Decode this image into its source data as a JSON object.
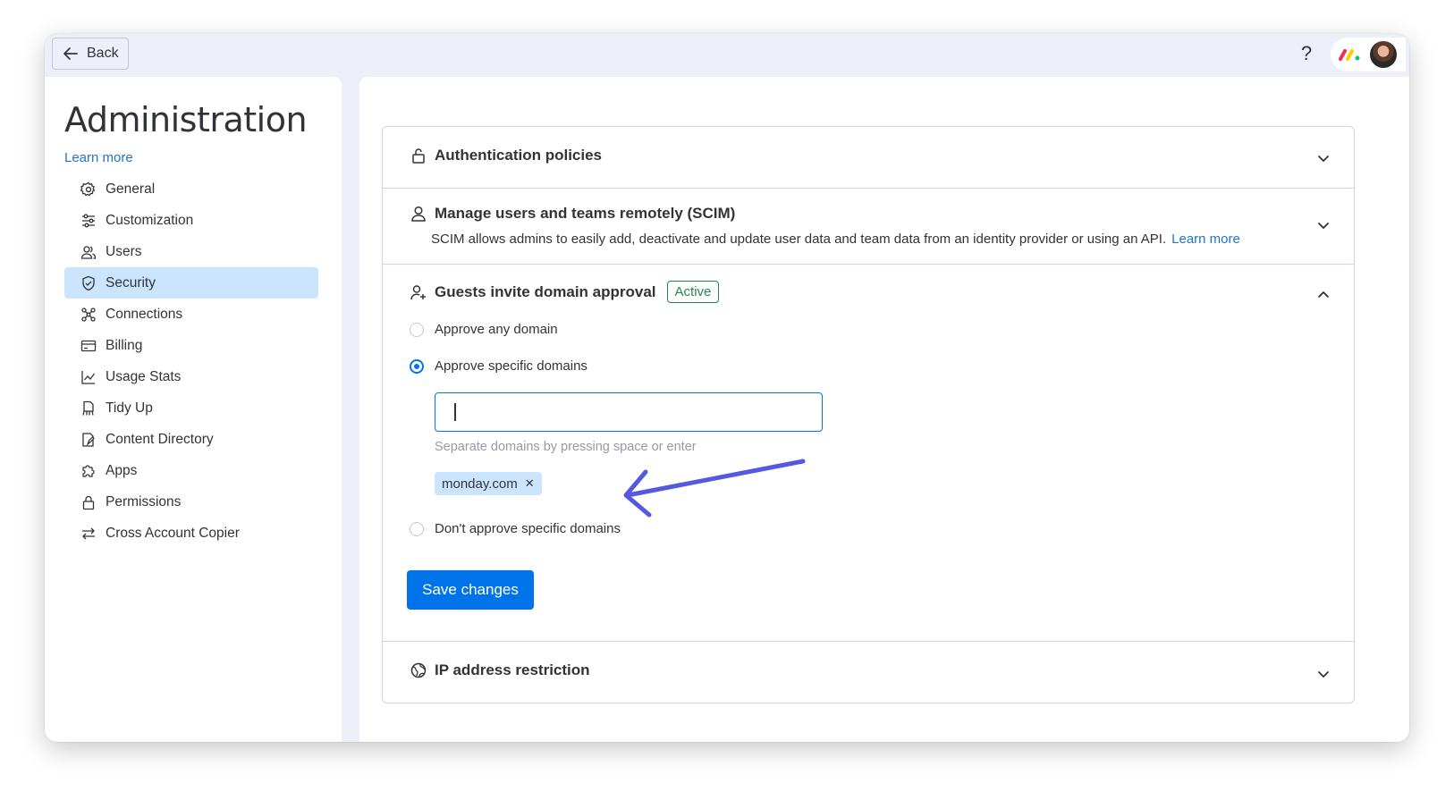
{
  "topbar": {
    "back_label": "Back",
    "help_glyph": "?"
  },
  "sidebar": {
    "title": "Administration",
    "learn_more": "Learn more",
    "items": [
      {
        "label": "General",
        "icon": "gear-icon"
      },
      {
        "label": "Customization",
        "icon": "sliders-icon"
      },
      {
        "label": "Users",
        "icon": "users-icon"
      },
      {
        "label": "Security",
        "icon": "shield-icon",
        "active": true
      },
      {
        "label": "Connections",
        "icon": "connections-icon"
      },
      {
        "label": "Billing",
        "icon": "credit-card-icon"
      },
      {
        "label": "Usage Stats",
        "icon": "chart-icon"
      },
      {
        "label": "Tidy Up",
        "icon": "broom-icon"
      },
      {
        "label": "Content Directory",
        "icon": "document-icon"
      },
      {
        "label": "Apps",
        "icon": "puzzle-icon"
      },
      {
        "label": "Permissions",
        "icon": "lock-icon"
      },
      {
        "label": "Cross Account Copier",
        "icon": "swap-icon"
      }
    ]
  },
  "sections": {
    "auth": {
      "title": "Authentication policies",
      "icon": "unlock-icon"
    },
    "scim": {
      "title": "Manage users and teams remotely (SCIM)",
      "icon": "user-icon",
      "description": "SCIM allows admins to easily add, deactivate and update user data and team data from an identity provider or using an API.",
      "learn_more": "Learn more"
    },
    "guests": {
      "title": "Guests invite domain approval",
      "icon": "user-plus-icon",
      "badge": "Active",
      "options": [
        {
          "label": "Approve any domain",
          "checked": false
        },
        {
          "label": "Approve specific domains",
          "checked": true
        },
        {
          "label": "Don't approve specific domains",
          "checked": false
        }
      ],
      "input_value": "",
      "hint": "Separate domains by pressing space or enter",
      "chips": [
        "monday.com"
      ],
      "save_label": "Save changes"
    },
    "ip": {
      "title": "IP address restriction",
      "icon": "globe-icon"
    }
  },
  "colors": {
    "primary": "#0073ea",
    "link": "#1f76c2",
    "active_bg": "#cce5ff",
    "badge_green": "#258750",
    "annotation_arrow": "#5559df"
  }
}
